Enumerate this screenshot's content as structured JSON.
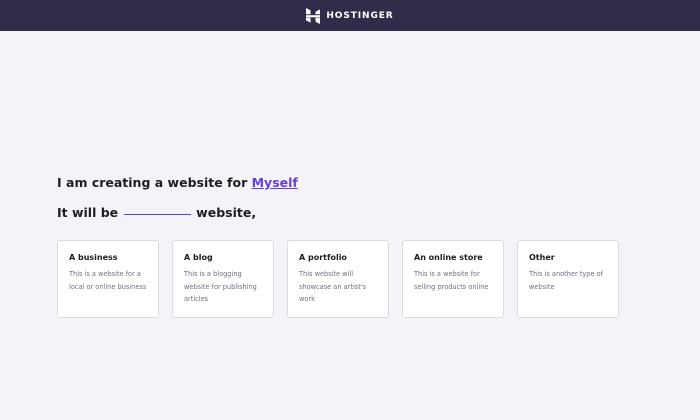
{
  "header": {
    "brand": "HOSTINGER",
    "logo_icon": "hostinger-logo-icon"
  },
  "prompt": {
    "line1_prefix": "I am creating a website for",
    "line1_choice": "Myself",
    "line2_prefix": "It will be",
    "line2_suffix": "website,"
  },
  "options": [
    {
      "title": "A business",
      "description": "This is a website for a local or online business"
    },
    {
      "title": "A blog",
      "description": "This is a blogging website for publishing articles"
    },
    {
      "title": "A portfolio",
      "description": "This website will showcase an artist's work"
    },
    {
      "title": "An online store",
      "description": "This is a website for selling products online"
    },
    {
      "title": "Other",
      "description": "This is another type of website"
    }
  ],
  "colors": {
    "accent": "#673de6",
    "header_bg": "#2f2d4a",
    "page_bg": "#f4f4f8"
  }
}
